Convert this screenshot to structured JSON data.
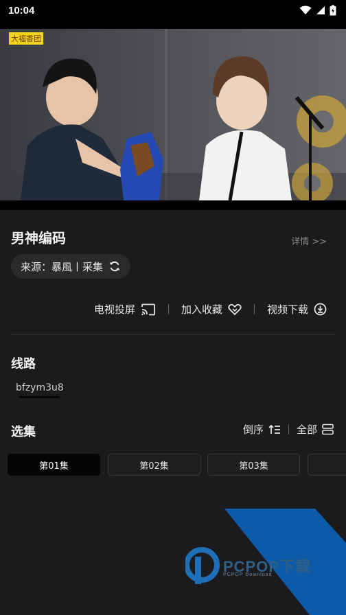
{
  "status_bar": {
    "time": "10:04"
  },
  "video": {
    "channel_tag": "大福香团"
  },
  "show": {
    "title": "男神编码",
    "details_link": "详情 >>",
    "source_label": "来源：暴風丨采集"
  },
  "actions": {
    "cast": "电视投屏",
    "favorite": "加入收藏",
    "download": "视频下载"
  },
  "routes": {
    "title": "线路",
    "items": [
      {
        "label": "bfzym3u8",
        "selected": true
      }
    ]
  },
  "episodes": {
    "title": "选集",
    "sort_label": "倒序",
    "all_label": "全部",
    "items": [
      {
        "label": "第01集",
        "active": true
      },
      {
        "label": "第02集",
        "active": false
      },
      {
        "label": "第03集",
        "active": false
      },
      {
        "label": "",
        "active": false
      }
    ]
  },
  "watermark": {
    "brand": "PCPOP下载",
    "sub": "PCPOP Download"
  },
  "colors": {
    "background": "#1b1b1d",
    "pill": "#2a2a2d",
    "accent_blue": "#0d5aa8",
    "active_episode": "#050505"
  }
}
